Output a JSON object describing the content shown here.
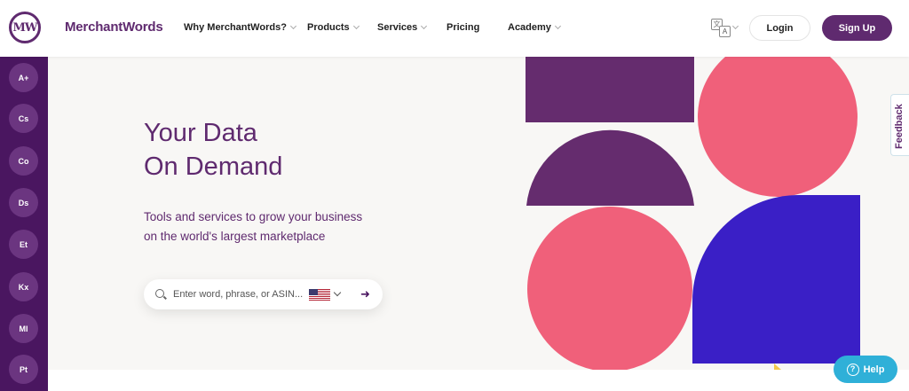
{
  "header": {
    "logo_text": "MW",
    "brand": "MerchantWords",
    "nav": [
      {
        "label": "Why MerchantWords?",
        "has_dropdown": true
      },
      {
        "label": "Products",
        "has_dropdown": true
      },
      {
        "label": "Services",
        "has_dropdown": true
      },
      {
        "label": "Pricing",
        "has_dropdown": false
      },
      {
        "label": "Academy",
        "has_dropdown": true
      }
    ],
    "language_icon": "translate-icon",
    "login_label": "Login",
    "signup_label": "Sign Up"
  },
  "sidebar": {
    "items": [
      "A+",
      "Cs",
      "Co",
      "Ds",
      "Et",
      "Kx",
      "Ml",
      "Pt"
    ]
  },
  "hero": {
    "title_line1": "Your Data",
    "title_line2": "On Demand",
    "subtitle_line1": "Tools and services to grow your business",
    "subtitle_line2": "on the world's largest marketplace",
    "search_placeholder": "Enter word, phrase, or ASIN...",
    "marketplace_flag": "us-flag-icon",
    "submit_icon": "arrow-right-icon"
  },
  "feedback_label": "Feedback",
  "help_label": "Help",
  "colors": {
    "brand_purple": "#5f2a6f",
    "sidebar_purple": "#4a1660",
    "coral": "#f0607a",
    "deep_purple": "#652c6e",
    "blue": "#3a1fc6",
    "help_blue": "#2fb0d8"
  }
}
